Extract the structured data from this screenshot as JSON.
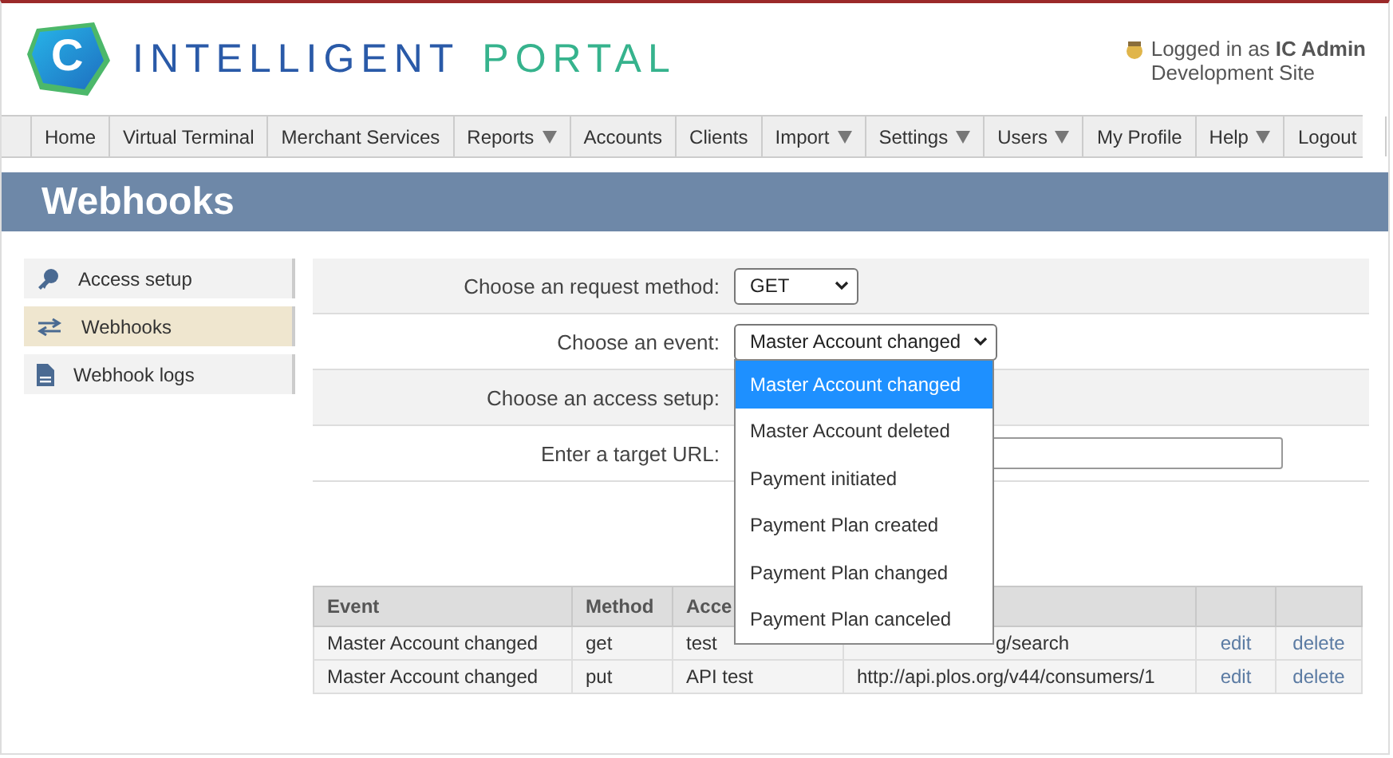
{
  "header": {
    "logo_letter": "C",
    "brand_first": "INTELLIGENT",
    "brand_second": "PORTAL",
    "user_prefix": "Logged in as ",
    "user_name": "IC Admin",
    "site": "Development Site"
  },
  "nav": [
    {
      "label": "Home",
      "has_menu": false
    },
    {
      "label": "Virtual Terminal",
      "has_menu": false
    },
    {
      "label": "Merchant Services",
      "has_menu": false
    },
    {
      "label": "Reports",
      "has_menu": true
    },
    {
      "label": "Accounts",
      "has_menu": false
    },
    {
      "label": "Clients",
      "has_menu": false
    },
    {
      "label": "Import",
      "has_menu": true
    },
    {
      "label": "Settings",
      "has_menu": true
    },
    {
      "label": "Users",
      "has_menu": true
    },
    {
      "label": "My Profile",
      "has_menu": false
    },
    {
      "label": "Help",
      "has_menu": true
    },
    {
      "label": "Logout",
      "has_menu": false
    }
  ],
  "page_title": "Webhooks",
  "sidebar": [
    {
      "label": "Access setup",
      "kind": "key",
      "selected": false
    },
    {
      "label": "Webhooks",
      "kind": "arrows",
      "selected": true
    },
    {
      "label": "Webhook logs",
      "kind": "file",
      "selected": false
    }
  ],
  "form": [
    {
      "label": "Choose an request method:",
      "kind": "select",
      "value": "GET"
    },
    {
      "label": "Choose an event:",
      "kind": "select",
      "value": "Master Account changed"
    },
    {
      "label": "Choose an access setup:",
      "kind": "hidden"
    },
    {
      "label": "Enter a target URL:",
      "kind": "input"
    }
  ],
  "event_options": [
    {
      "label": "Master Account changed",
      "selected": true
    },
    {
      "label": "Master Account deleted",
      "selected": false
    },
    {
      "label": "Payment initiated",
      "selected": false
    },
    {
      "label": "Payment Plan created",
      "selected": false
    },
    {
      "label": "Payment Plan changed",
      "selected": false
    },
    {
      "label": "Payment Plan canceled",
      "selected": false
    }
  ],
  "table": {
    "columns": [
      "Event",
      "Method",
      "Acce"
    ],
    "rows": [
      {
        "event": "Master Account changed",
        "method": "get",
        "access": "test",
        "url": "g/search",
        "url_hidden": true,
        "edit": "edit",
        "delete": "delete"
      },
      {
        "event": "Master Account changed",
        "method": "put",
        "access": "API test",
        "url": "http://api.plos.org/v44/consumers/1",
        "url_hidden": false,
        "edit": "edit",
        "delete": "delete"
      }
    ]
  }
}
